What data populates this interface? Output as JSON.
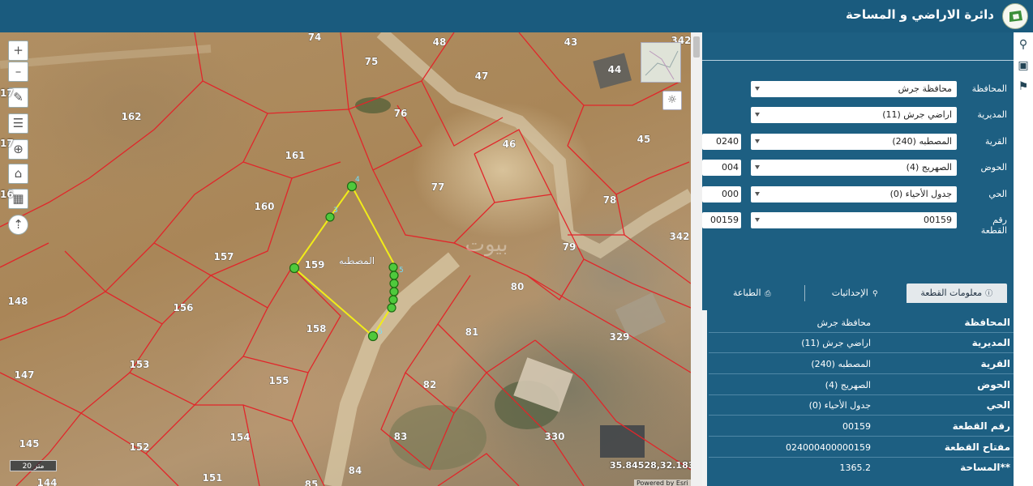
{
  "header": {
    "title": "دائرة الاراضي و المساحة",
    "logo_icon": "dls-logo"
  },
  "map": {
    "controls": [
      {
        "name": "zoom-in-button",
        "glyph": "+"
      },
      {
        "name": "zoom-out-button",
        "glyph": "–"
      },
      {
        "name": "draw-pencil-button",
        "glyph": "✎"
      },
      {
        "name": "measure-button",
        "glyph": "☰"
      },
      {
        "name": "locate-button",
        "glyph": "⊕"
      },
      {
        "name": "home-button",
        "glyph": "⌂"
      },
      {
        "name": "chart-button",
        "glyph": "▦"
      },
      {
        "name": "compass-button",
        "glyph": "⇡"
      }
    ],
    "side_cut_numbers": [
      "17",
      "17",
      "16"
    ],
    "sun_icon": "☼",
    "scale_label": "20 متر",
    "coordinates": "35.84528,32.18313",
    "powered_by": "Powered by Esri",
    "parcel_label": "المصطبه",
    "watermark": "بيوت",
    "plot_numbers": [
      "74",
      "48",
      "43",
      "342",
      "75",
      "47",
      "44",
      "162",
      "76",
      "46",
      "45",
      "161",
      "77",
      "160",
      "78",
      "157",
      "159",
      "79",
      "342",
      "148",
      "156",
      "80",
      "158",
      "81",
      "329",
      "153",
      "147",
      "155",
      "82",
      "145",
      "152",
      "154",
      "83",
      "330",
      "151",
      "84",
      "144",
      "85"
    ],
    "vertex_labels": [
      "4",
      "3",
      "6",
      "5"
    ],
    "colors": {
      "parcel_line": "#e1262a",
      "selection_line": "#f1ec19",
      "vertex": "#4fc93c"
    }
  },
  "panel": {
    "fields": [
      {
        "label": "المحافظة",
        "value": "محافظة جرش",
        "code": ""
      },
      {
        "label": "المديرية",
        "value": "اراضي جرش (11)",
        "code": ""
      },
      {
        "label": "القرية",
        "value": "المصطبه (240)",
        "code": "0240"
      },
      {
        "label": "الحوض",
        "value": "الصهريج (4)",
        "code": "004"
      },
      {
        "label": "الحي",
        "value": "جدول الأحياء (0)",
        "code": "000"
      },
      {
        "label": "رقم القطعة",
        "value": "00159",
        "code": "00159"
      }
    ],
    "tabs": [
      {
        "label": "معلومات القطعة",
        "icon": "info-icon",
        "glyph": "ⓘ"
      },
      {
        "label": "الإحداثيات",
        "icon": "pin-icon",
        "glyph": "⚲"
      },
      {
        "label": "الطباعة",
        "icon": "print-icon",
        "glyph": "⎙"
      }
    ],
    "info": [
      {
        "key": "المحافظة",
        "value": "محافظة جرش"
      },
      {
        "key": "المديرية",
        "value": "اراضي جرش (11)"
      },
      {
        "key": "القرية",
        "value": "المصطبه (240)"
      },
      {
        "key": "الحوض",
        "value": "الصهريج (4)"
      },
      {
        "key": "الحي",
        "value": "جدول الأحياء (0)"
      },
      {
        "key": "رقم القطعة",
        "value": "00159"
      },
      {
        "key": "مفتاح القطعة",
        "value": "024000400000159"
      },
      {
        "key": "**المساحة",
        "value": "1365.2"
      }
    ]
  },
  "rail": [
    {
      "name": "search-icon",
      "glyph": "⚲"
    },
    {
      "name": "layers-icon",
      "glyph": "▣"
    },
    {
      "name": "location-pin-icon",
      "glyph": "⚑"
    }
  ]
}
